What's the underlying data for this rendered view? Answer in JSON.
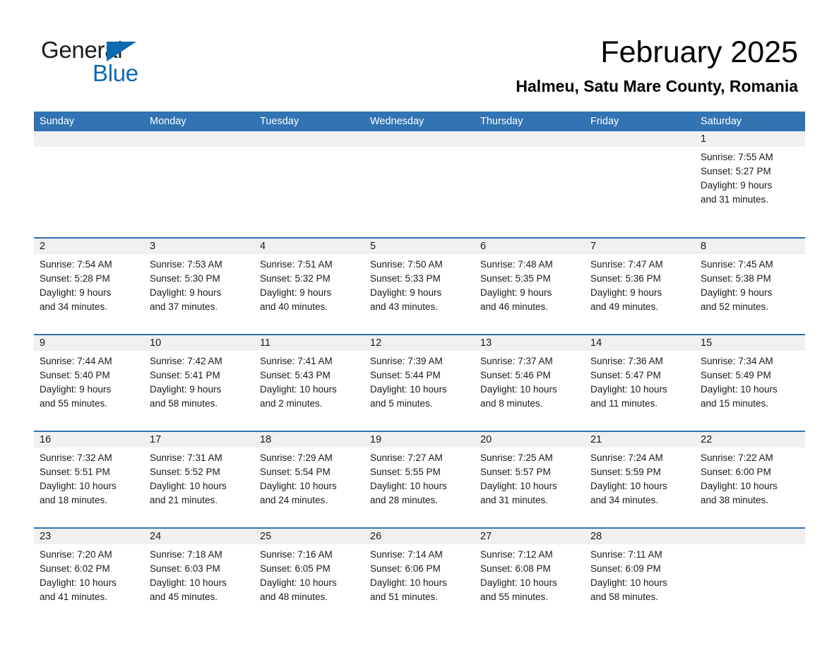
{
  "brand": {
    "name_part1": "General",
    "name_part2": "Blue",
    "accent_color": "#0d6ab0"
  },
  "header": {
    "month_title": "February 2025",
    "location": "Halmeu, Satu Mare County, Romania",
    "header_bg_color": "#3173b3",
    "date_band_color": "#f0f0f0"
  },
  "weekdays": [
    "Sunday",
    "Monday",
    "Tuesday",
    "Wednesday",
    "Thursday",
    "Friday",
    "Saturday"
  ],
  "weeks": [
    {
      "days": [
        {
          "date": "",
          "lines": []
        },
        {
          "date": "",
          "lines": []
        },
        {
          "date": "",
          "lines": []
        },
        {
          "date": "",
          "lines": []
        },
        {
          "date": "",
          "lines": []
        },
        {
          "date": "",
          "lines": []
        },
        {
          "date": "1",
          "lines": [
            "Sunrise: 7:55 AM",
            "Sunset: 5:27 PM",
            "Daylight: 9 hours",
            "and 31 minutes."
          ]
        }
      ]
    },
    {
      "days": [
        {
          "date": "2",
          "lines": [
            "Sunrise: 7:54 AM",
            "Sunset: 5:28 PM",
            "Daylight: 9 hours",
            "and 34 minutes."
          ]
        },
        {
          "date": "3",
          "lines": [
            "Sunrise: 7:53 AM",
            "Sunset: 5:30 PM",
            "Daylight: 9 hours",
            "and 37 minutes."
          ]
        },
        {
          "date": "4",
          "lines": [
            "Sunrise: 7:51 AM",
            "Sunset: 5:32 PM",
            "Daylight: 9 hours",
            "and 40 minutes."
          ]
        },
        {
          "date": "5",
          "lines": [
            "Sunrise: 7:50 AM",
            "Sunset: 5:33 PM",
            "Daylight: 9 hours",
            "and 43 minutes."
          ]
        },
        {
          "date": "6",
          "lines": [
            "Sunrise: 7:48 AM",
            "Sunset: 5:35 PM",
            "Daylight: 9 hours",
            "and 46 minutes."
          ]
        },
        {
          "date": "7",
          "lines": [
            "Sunrise: 7:47 AM",
            "Sunset: 5:36 PM",
            "Daylight: 9 hours",
            "and 49 minutes."
          ]
        },
        {
          "date": "8",
          "lines": [
            "Sunrise: 7:45 AM",
            "Sunset: 5:38 PM",
            "Daylight: 9 hours",
            "and 52 minutes."
          ]
        }
      ]
    },
    {
      "days": [
        {
          "date": "9",
          "lines": [
            "Sunrise: 7:44 AM",
            "Sunset: 5:40 PM",
            "Daylight: 9 hours",
            "and 55 minutes."
          ]
        },
        {
          "date": "10",
          "lines": [
            "Sunrise: 7:42 AM",
            "Sunset: 5:41 PM",
            "Daylight: 9 hours",
            "and 58 minutes."
          ]
        },
        {
          "date": "11",
          "lines": [
            "Sunrise: 7:41 AM",
            "Sunset: 5:43 PM",
            "Daylight: 10 hours",
            "and 2 minutes."
          ]
        },
        {
          "date": "12",
          "lines": [
            "Sunrise: 7:39 AM",
            "Sunset: 5:44 PM",
            "Daylight: 10 hours",
            "and 5 minutes."
          ]
        },
        {
          "date": "13",
          "lines": [
            "Sunrise: 7:37 AM",
            "Sunset: 5:46 PM",
            "Daylight: 10 hours",
            "and 8 minutes."
          ]
        },
        {
          "date": "14",
          "lines": [
            "Sunrise: 7:36 AM",
            "Sunset: 5:47 PM",
            "Daylight: 10 hours",
            "and 11 minutes."
          ]
        },
        {
          "date": "15",
          "lines": [
            "Sunrise: 7:34 AM",
            "Sunset: 5:49 PM",
            "Daylight: 10 hours",
            "and 15 minutes."
          ]
        }
      ]
    },
    {
      "days": [
        {
          "date": "16",
          "lines": [
            "Sunrise: 7:32 AM",
            "Sunset: 5:51 PM",
            "Daylight: 10 hours",
            "and 18 minutes."
          ]
        },
        {
          "date": "17",
          "lines": [
            "Sunrise: 7:31 AM",
            "Sunset: 5:52 PM",
            "Daylight: 10 hours",
            "and 21 minutes."
          ]
        },
        {
          "date": "18",
          "lines": [
            "Sunrise: 7:29 AM",
            "Sunset: 5:54 PM",
            "Daylight: 10 hours",
            "and 24 minutes."
          ]
        },
        {
          "date": "19",
          "lines": [
            "Sunrise: 7:27 AM",
            "Sunset: 5:55 PM",
            "Daylight: 10 hours",
            "and 28 minutes."
          ]
        },
        {
          "date": "20",
          "lines": [
            "Sunrise: 7:25 AM",
            "Sunset: 5:57 PM",
            "Daylight: 10 hours",
            "and 31 minutes."
          ]
        },
        {
          "date": "21",
          "lines": [
            "Sunrise: 7:24 AM",
            "Sunset: 5:59 PM",
            "Daylight: 10 hours",
            "and 34 minutes."
          ]
        },
        {
          "date": "22",
          "lines": [
            "Sunrise: 7:22 AM",
            "Sunset: 6:00 PM",
            "Daylight: 10 hours",
            "and 38 minutes."
          ]
        }
      ]
    },
    {
      "days": [
        {
          "date": "23",
          "lines": [
            "Sunrise: 7:20 AM",
            "Sunset: 6:02 PM",
            "Daylight: 10 hours",
            "and 41 minutes."
          ]
        },
        {
          "date": "24",
          "lines": [
            "Sunrise: 7:18 AM",
            "Sunset: 6:03 PM",
            "Daylight: 10 hours",
            "and 45 minutes."
          ]
        },
        {
          "date": "25",
          "lines": [
            "Sunrise: 7:16 AM",
            "Sunset: 6:05 PM",
            "Daylight: 10 hours",
            "and 48 minutes."
          ]
        },
        {
          "date": "26",
          "lines": [
            "Sunrise: 7:14 AM",
            "Sunset: 6:06 PM",
            "Daylight: 10 hours",
            "and 51 minutes."
          ]
        },
        {
          "date": "27",
          "lines": [
            "Sunrise: 7:12 AM",
            "Sunset: 6:08 PM",
            "Daylight: 10 hours",
            "and 55 minutes."
          ]
        },
        {
          "date": "28",
          "lines": [
            "Sunrise: 7:11 AM",
            "Sunset: 6:09 PM",
            "Daylight: 10 hours",
            "and 58 minutes."
          ]
        },
        {
          "date": "",
          "lines": []
        }
      ]
    }
  ]
}
